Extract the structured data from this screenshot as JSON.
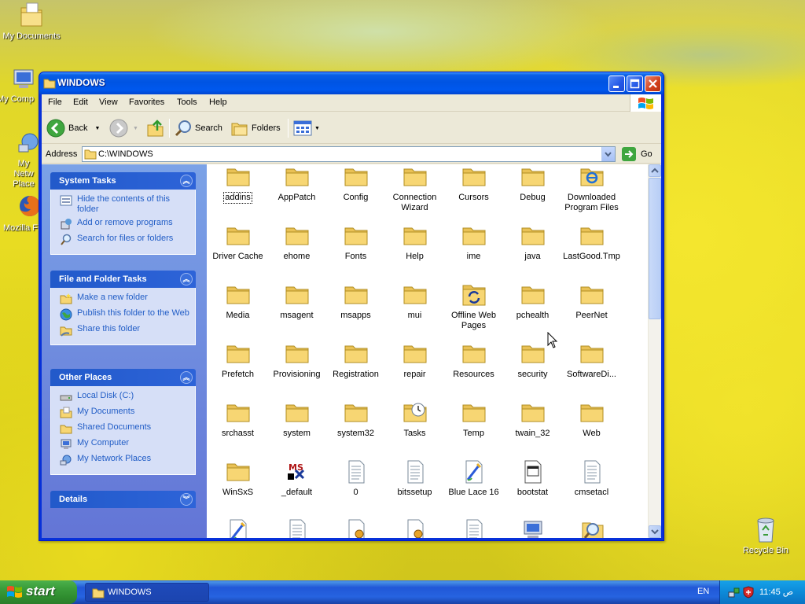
{
  "desktop": {
    "icons": [
      {
        "label": "My Documents"
      },
      {
        "label": "My Comp"
      },
      {
        "label": "My Netw Place"
      },
      {
        "label": "Mozilla Fi"
      },
      {
        "label": "Recycle Bin"
      }
    ]
  },
  "window": {
    "title": "WINDOWS",
    "menu": [
      "File",
      "Edit",
      "View",
      "Favorites",
      "Tools",
      "Help"
    ],
    "toolbar": {
      "back": "Back",
      "search": "Search",
      "folders": "Folders"
    },
    "address": {
      "label": "Address",
      "value": "C:\\WINDOWS",
      "go": "Go"
    }
  },
  "taskpane": {
    "system_tasks": {
      "title": "System Tasks",
      "items": [
        "Hide the contents of this folder",
        "Add or remove programs",
        "Search for files or folders"
      ]
    },
    "file_folder_tasks": {
      "title": "File and Folder Tasks",
      "items": [
        "Make a new folder",
        "Publish this folder to the Web",
        "Share this folder"
      ]
    },
    "other_places": {
      "title": "Other Places",
      "items": [
        "Local Disk (C:)",
        "My Documents",
        "Shared Documents",
        "My Computer",
        "My Network Places"
      ]
    },
    "details": {
      "title": "Details"
    }
  },
  "files": [
    {
      "name": "addins",
      "icon": "folder-icon"
    },
    {
      "name": "AppPatch",
      "icon": "folder-icon"
    },
    {
      "name": "Config",
      "icon": "folder-icon"
    },
    {
      "name": "Connection Wizard",
      "icon": "folder-icon"
    },
    {
      "name": "Cursors",
      "icon": "folder-icon"
    },
    {
      "name": "Debug",
      "icon": "folder-icon"
    },
    {
      "name": "Downloaded Program Files",
      "icon": "ie-folder-icon"
    },
    {
      "name": "Driver Cache",
      "icon": "folder-icon"
    },
    {
      "name": "ehome",
      "icon": "folder-icon"
    },
    {
      "name": "Fonts",
      "icon": "folder-icon"
    },
    {
      "name": "Help",
      "icon": "folder-icon"
    },
    {
      "name": "ime",
      "icon": "folder-icon"
    },
    {
      "name": "java",
      "icon": "folder-icon"
    },
    {
      "name": "LastGood.Tmp",
      "icon": "folder-icon"
    },
    {
      "name": "Media",
      "icon": "folder-icon"
    },
    {
      "name": "msagent",
      "icon": "folder-icon"
    },
    {
      "name": "msapps",
      "icon": "folder-icon"
    },
    {
      "name": "mui",
      "icon": "folder-icon"
    },
    {
      "name": "Offline Web Pages",
      "icon": "sync-folder-icon"
    },
    {
      "name": "pchealth",
      "icon": "folder-icon"
    },
    {
      "name": "PeerNet",
      "icon": "folder-icon"
    },
    {
      "name": "Prefetch",
      "icon": "folder-icon"
    },
    {
      "name": "Provisioning",
      "icon": "folder-icon"
    },
    {
      "name": "Registration",
      "icon": "folder-icon"
    },
    {
      "name": "repair",
      "icon": "folder-icon"
    },
    {
      "name": "Resources",
      "icon": "folder-icon"
    },
    {
      "name": "security",
      "icon": "folder-icon"
    },
    {
      "name": "SoftwareDi...",
      "icon": "folder-icon"
    },
    {
      "name": "srchasst",
      "icon": "folder-icon"
    },
    {
      "name": "system",
      "icon": "folder-icon"
    },
    {
      "name": "system32",
      "icon": "folder-icon"
    },
    {
      "name": "Tasks",
      "icon": "tasks-folder-icon"
    },
    {
      "name": "Temp",
      "icon": "folder-icon"
    },
    {
      "name": "twain_32",
      "icon": "folder-icon"
    },
    {
      "name": "Web",
      "icon": "folder-icon"
    },
    {
      "name": "WinSxS",
      "icon": "folder-icon"
    },
    {
      "name": "_default",
      "icon": "ms-app-icon"
    },
    {
      "name": "0",
      "icon": "text-file-icon"
    },
    {
      "name": "bitssetup",
      "icon": "text-file-icon"
    },
    {
      "name": "Blue Lace 16",
      "icon": "bitmap-file-icon"
    },
    {
      "name": "bootstat",
      "icon": "dat-file-icon"
    },
    {
      "name": "cmsetacl",
      "icon": "text-file-icon"
    },
    {
      "name": "",
      "icon": "bitmap-file-icon"
    },
    {
      "name": "",
      "icon": "text-file-icon"
    },
    {
      "name": "",
      "icon": "config-file-icon"
    },
    {
      "name": "",
      "icon": "config-file-icon"
    },
    {
      "name": "",
      "icon": "text-file-icon"
    },
    {
      "name": "",
      "icon": "computer-file-icon"
    },
    {
      "name": "",
      "icon": "search-file-icon"
    }
  ],
  "taskbar": {
    "start": "start",
    "task": "WINDOWS",
    "language": "EN",
    "clock": "11:45 ص"
  },
  "colors": {
    "xp_blue": "#0054e3",
    "link_blue": "#215dc6",
    "start_green": "#3c9f3c",
    "folder_yellow": "#f7d673"
  }
}
